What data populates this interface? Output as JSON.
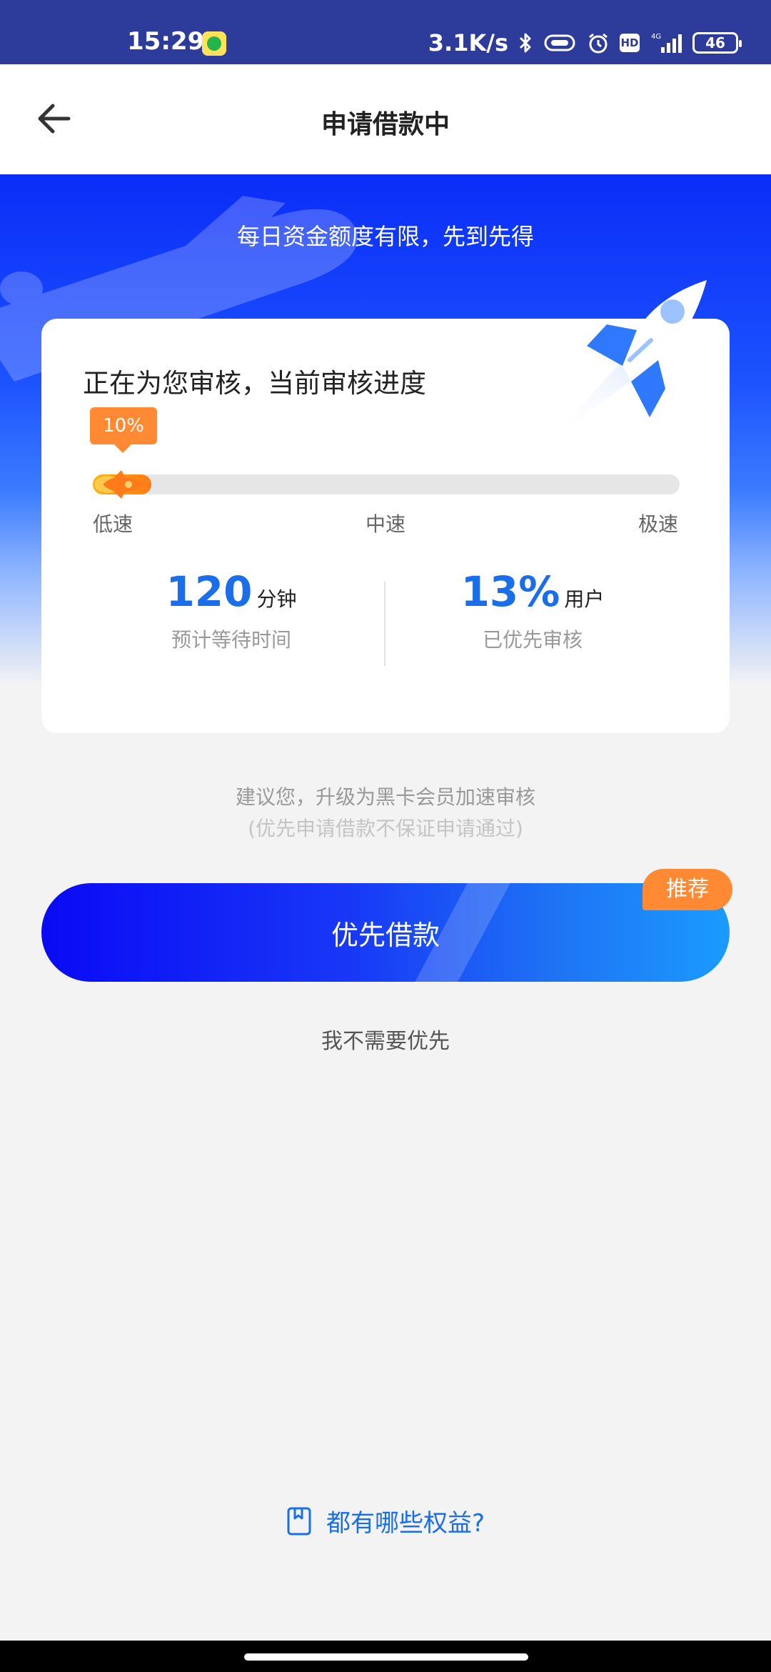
{
  "status_bar": {
    "time": "15:29",
    "net_speed": "3.1K/s",
    "hd": "HD",
    "network": "4G",
    "battery": "46",
    "icons": [
      "app-icon",
      "bluetooth-icon",
      "vibrate-icon",
      "alarm-icon",
      "hd-icon",
      "signal-icon",
      "battery-icon"
    ]
  },
  "header": {
    "title": "申请借款中",
    "back_icon": "arrow-left-icon"
  },
  "banner": {
    "text": "每日资金额度有限，先到先得"
  },
  "card": {
    "title": "正在为您审核，当前审核进度",
    "progress_label": "10%",
    "progress": 0.1,
    "speed_labels": {
      "low": "低速",
      "mid": "中速",
      "high": "极速"
    },
    "stats": [
      {
        "value": "120",
        "unit": "分钟",
        "label": "预计等待时间"
      },
      {
        "value": "13%",
        "unit": "用户",
        "label": "已优先审核"
      }
    ]
  },
  "suggestion": {
    "text": "建议您，升级为黑卡会员加速审核",
    "subtext": "(优先申请借款不保证申请通过)"
  },
  "primary_button": {
    "label": "优先借款",
    "badge": "推荐"
  },
  "skip_link": "我不需要优先",
  "benefits_link": {
    "text": "都有哪些权益?",
    "icon": "bookmark-icon"
  },
  "colors": {
    "accent_blue": "#1a6ee9",
    "orange": "#ff8a33",
    "status_bar": "#2d3b9a"
  }
}
